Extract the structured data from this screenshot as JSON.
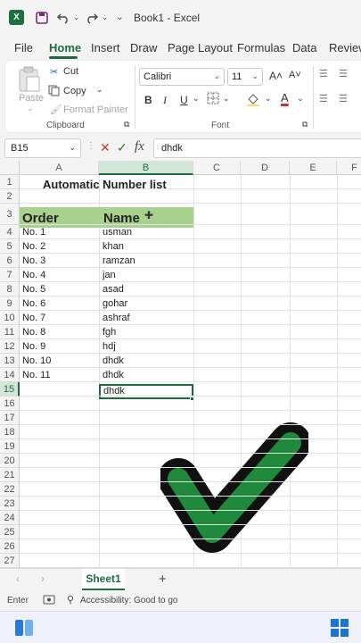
{
  "window": {
    "title": "Book1  -  Excel",
    "qat_more": "⌄"
  },
  "menu": {
    "items": [
      "File",
      "Home",
      "Insert",
      "Draw",
      "Page Layout",
      "Formulas",
      "Data",
      "Review"
    ],
    "active": "Home"
  },
  "ribbon": {
    "paste_label": "Paste",
    "cut_label": "Cut",
    "copy_label": "Copy",
    "format_painter_label": "Format Painter",
    "clipboard_group": "Clipboard",
    "font_name": "Calibri",
    "font_size": "11",
    "font_group": "Font",
    "bold": "B",
    "italic": "I",
    "underline": "U",
    "grow_font": "A˄",
    "shrink_font": "A˅",
    "font_color_letter": "A"
  },
  "formula_bar": {
    "name_box": "B15",
    "fx": "fx",
    "content": "dhdk"
  },
  "grid": {
    "columns": [
      "A",
      "B",
      "C",
      "D",
      "E",
      "F"
    ],
    "selected_column": "B",
    "rows": [
      "1",
      "2",
      "3",
      "4",
      "5",
      "6",
      "7",
      "8",
      "9",
      "10",
      "11",
      "12",
      "13",
      "14",
      "15",
      "16",
      "17",
      "18",
      "19",
      "20",
      "21",
      "22",
      "23",
      "24",
      "25",
      "26",
      "27"
    ],
    "selected_row": "15",
    "title": "Automatic Number list",
    "header_order": "Order",
    "header_name": "Name",
    "orders": [
      "No. 1",
      "No. 2",
      "No. 3",
      "No. 4",
      "No. 5",
      "No. 6",
      "No. 7",
      "No. 8",
      "No. 9",
      "No. 10",
      "No. 11"
    ],
    "names": [
      "usman",
      "khan",
      "ramzan",
      "jan",
      "asad",
      "gohar",
      "ashraf",
      "fgh",
      "hdj",
      "dhdk",
      "dhdk"
    ],
    "active_cell_value": "dhdk"
  },
  "tabs": {
    "sheet": "Sheet1",
    "add": "+"
  },
  "status": {
    "mode": "Enter",
    "accessibility": "Accessibility: Good to go"
  },
  "colors": {
    "accent": "#1e6b3f",
    "header_fill": "#a9d18e",
    "checkmark": "#1f8a3c"
  }
}
